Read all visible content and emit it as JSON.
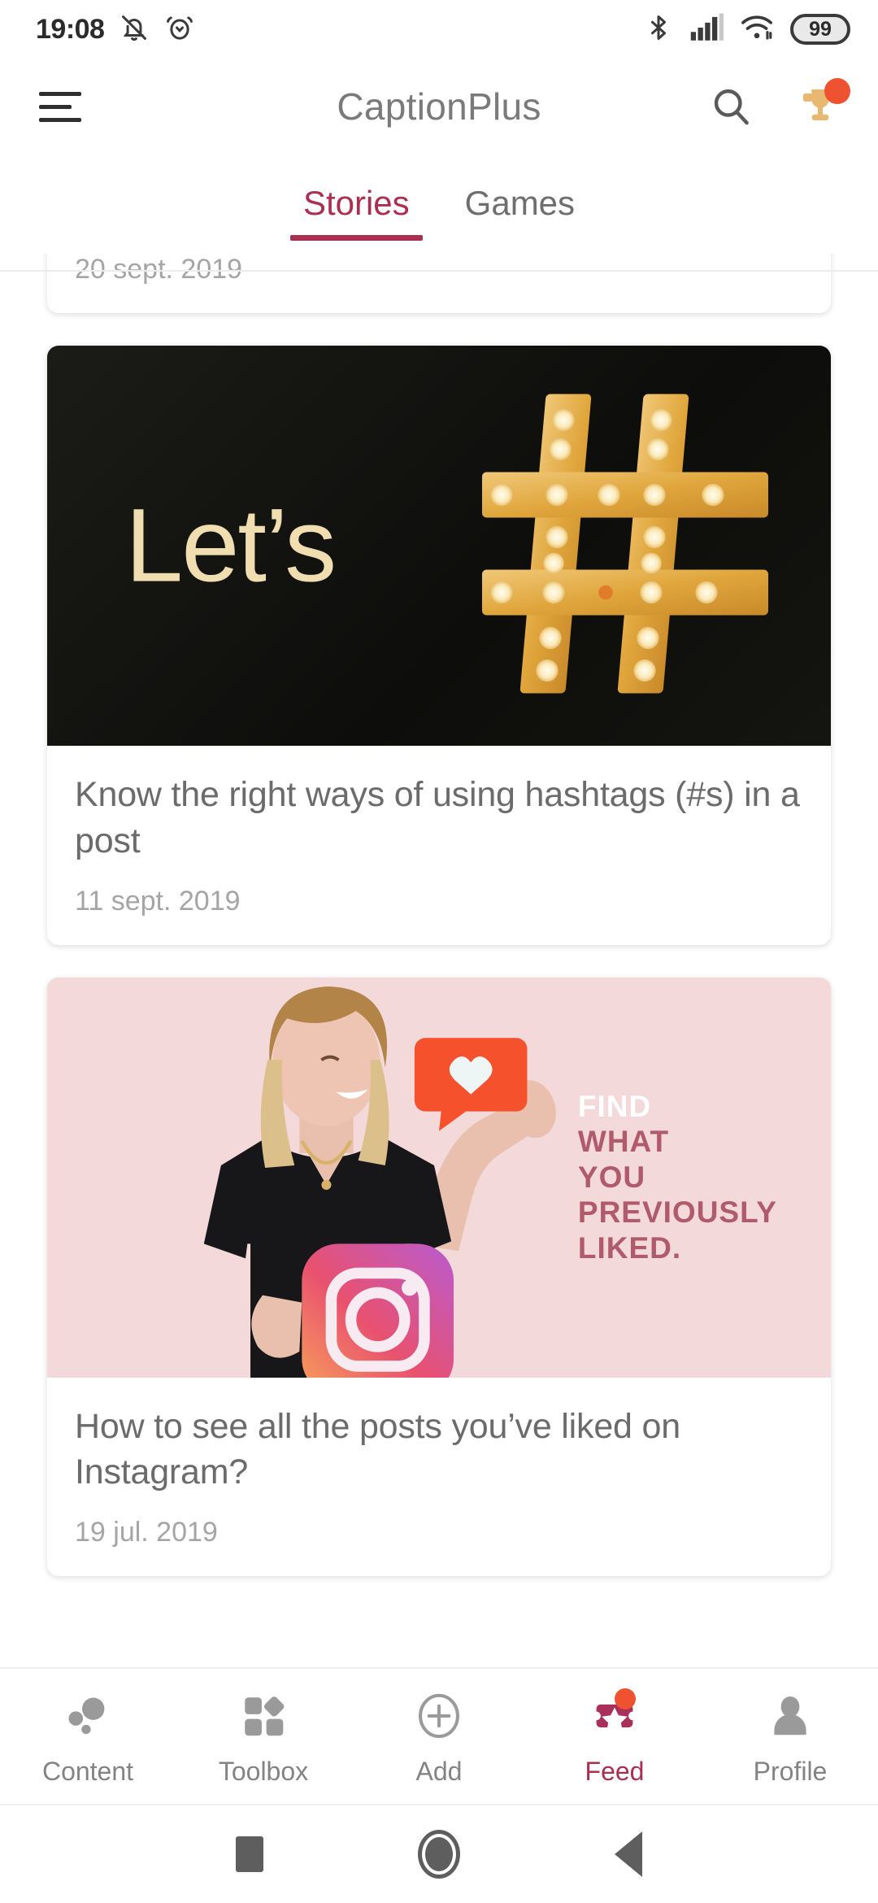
{
  "status_bar": {
    "time": "19:08",
    "battery_level": "99",
    "icons": [
      "bell-muted-icon",
      "alarm-clock-icon",
      "bluetooth-icon",
      "cellular-signal-icon",
      "wifi-icon",
      "battery-icon"
    ]
  },
  "app_bar": {
    "title": "CaptionPlus",
    "menu_icon": "hamburger-menu-icon",
    "search_icon": "search-icon",
    "trophy_icon": "trophy-icon",
    "trophy_has_notification": true
  },
  "tabs": {
    "items": [
      {
        "label": "Stories",
        "active": true
      },
      {
        "label": "Games",
        "active": false
      }
    ],
    "active_color": "#ab2f51",
    "inactive_color": "#6e6e6e"
  },
  "feed": {
    "cards": [
      {
        "title": "",
        "date": "20 sept. 2019",
        "partial": true
      },
      {
        "title": "Know the right ways of using hashtags (#s) in a post",
        "date": "11 sept. 2019",
        "media_type": "hashtag-marquee",
        "media_text": "Let’s",
        "media_bg": "#141410",
        "media_accent": "#e3a93c"
      },
      {
        "title": "How to see all the posts you’ve liked on Instagram?",
        "date": "19 jul. 2019",
        "media_type": "instagram-photo",
        "media_bg": "#f3d9da",
        "overlay_lines": [
          "FIND",
          "WHAT",
          "YOU",
          "PREVIOUSLY",
          "LIKED."
        ],
        "overlay_first_color": "#ffffff",
        "overlay_rest_color": "#b05b6b"
      }
    ]
  },
  "bottom_nav": {
    "items": [
      {
        "label": "Content",
        "icon": "bubbles-icon",
        "active": false,
        "badge": false
      },
      {
        "label": "Toolbox",
        "icon": "grid-shapes-icon",
        "active": false,
        "badge": false
      },
      {
        "label": "Add",
        "icon": "plus-circle-icon",
        "active": false,
        "badge": false
      },
      {
        "label": "Feed",
        "icon": "ticket-star-icon",
        "active": true,
        "badge": true
      },
      {
        "label": "Profile",
        "icon": "person-icon",
        "active": false,
        "badge": false
      }
    ]
  },
  "android_nav": {
    "recents_icon": "square-recents-icon",
    "home_icon": "circle-home-icon",
    "back_icon": "triangle-back-icon"
  },
  "colors": {
    "accent": "#ab2f51",
    "notification": "#ef5230",
    "trophy": "#e8b872",
    "text_primary": "#6b6b6b",
    "text_secondary": "#a5a5a5"
  }
}
